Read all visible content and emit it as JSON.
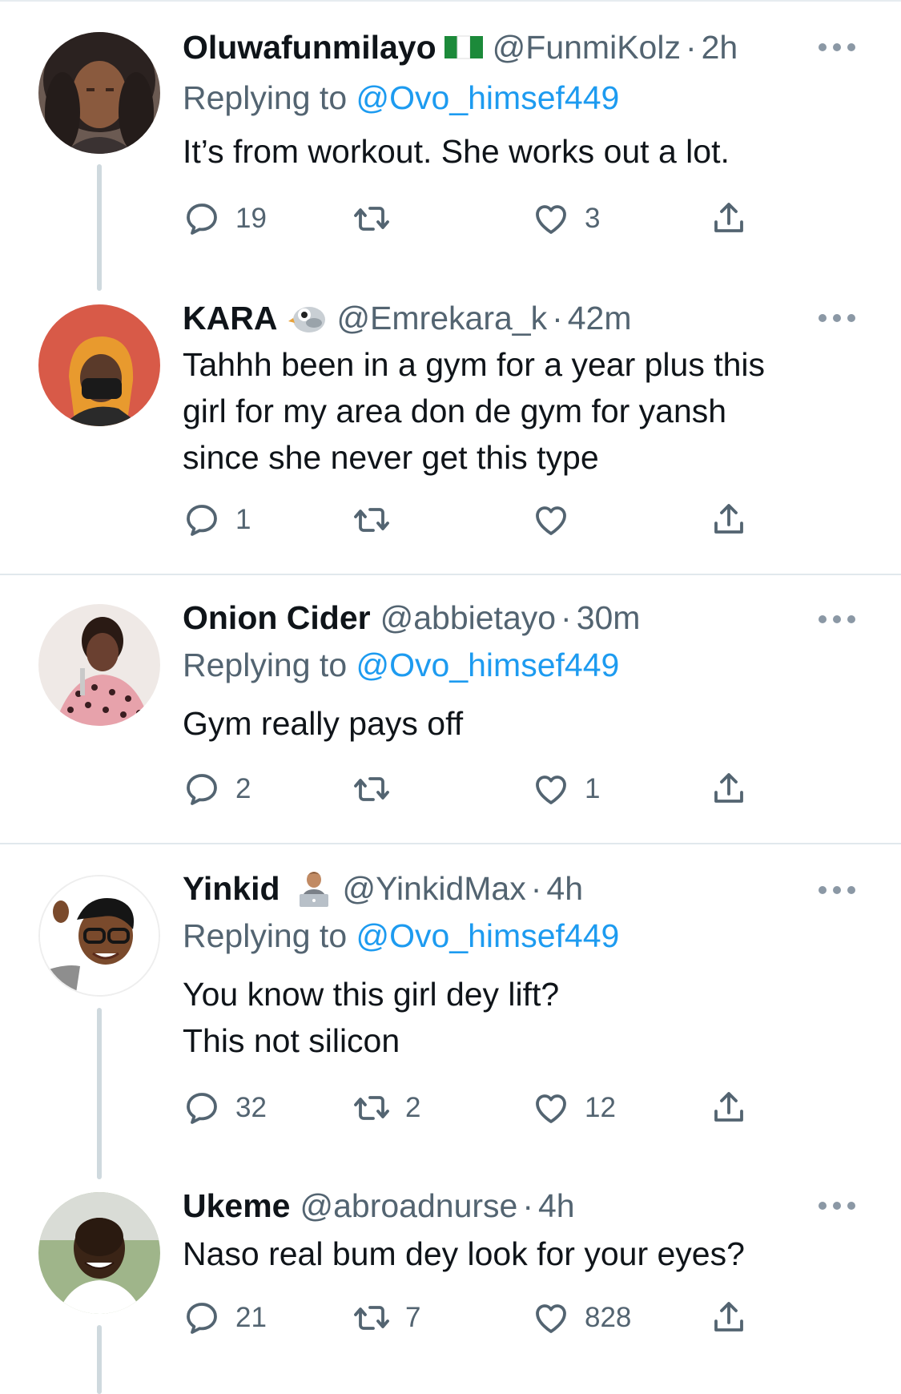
{
  "tweets": [
    {
      "name": "Oluwafunmilayo",
      "handle": "@FunmiKolz",
      "dot": "·",
      "time": "2h",
      "replying_prefix": "Replying to ",
      "replying_to": "@Ovo_himsef449",
      "text_lines": [
        "It’s from workout. She works out a lot."
      ],
      "replies": "19",
      "retweets": "",
      "likes": "3",
      "badge": "nigeria-flag"
    },
    {
      "name": "KARA",
      "handle": "@Emrekara_k",
      "dot": "·",
      "time": "42m",
      "replying_prefix": "",
      "replying_to": "",
      "text_lines": [
        "Tahhh been in a gym for a year plus this",
        "girl for my area don de gym for yansh",
        "since she never get this type"
      ],
      "replies": "1",
      "retweets": "",
      "likes": "",
      "badge": "bird-emoji"
    },
    {
      "name": "Onion Cider",
      "handle": "@abbietayo",
      "dot": "·",
      "time": "30m",
      "replying_prefix": "Replying to ",
      "replying_to": "@Ovo_himsef449",
      "text_lines": [
        "Gym really pays off"
      ],
      "replies": "2",
      "retweets": "",
      "likes": "1",
      "badge": ""
    },
    {
      "name": "Yinkid",
      "handle": "@YinkidMax",
      "dot": "·",
      "time": "4h",
      "replying_prefix": "Replying to ",
      "replying_to": "@Ovo_himsef449",
      "text_lines": [
        "You know this girl dey lift?",
        "This not silicon"
      ],
      "replies": "32",
      "retweets": "2",
      "likes": "12",
      "badge": "technologist-emoji"
    },
    {
      "name": "Ukeme",
      "handle": "@abroadnurse",
      "dot": "·",
      "time": "4h",
      "replying_prefix": "",
      "replying_to": "",
      "text_lines": [
        "Naso real bum dey look for your eyes?"
      ],
      "replies": "21",
      "retweets": "7",
      "likes": "828",
      "badge": ""
    }
  ],
  "colors": {
    "text": "#0f1419",
    "muted": "#536471",
    "link": "#1d9bf0",
    "divider": "#e1e8ed",
    "thread_line": "#cfd9de"
  }
}
